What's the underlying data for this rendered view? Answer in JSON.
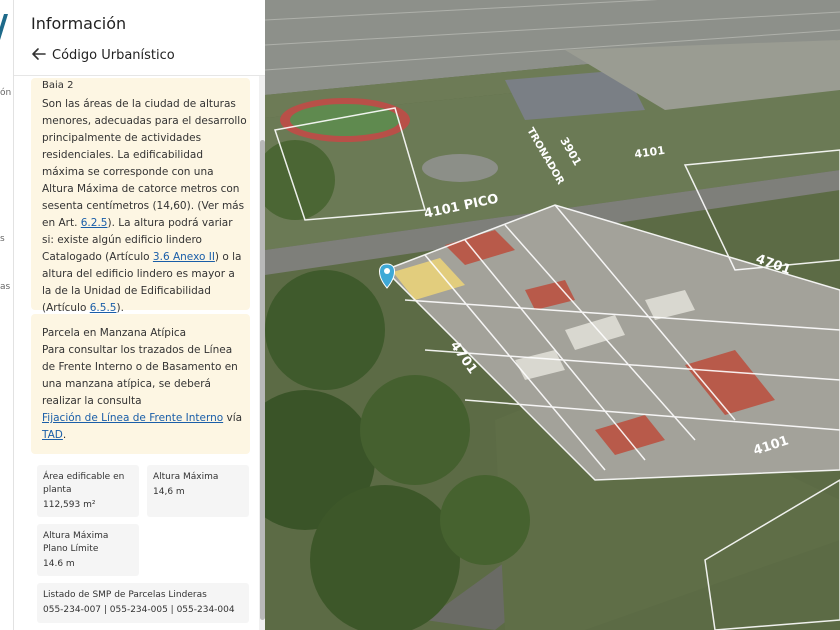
{
  "rail": {
    "items": [
      "ón",
      "s",
      "as"
    ]
  },
  "panel": {
    "title": "Información",
    "subtitle": "Código Urbanístico"
  },
  "card_zone": {
    "clipped_title": "Baja 2",
    "text_before_link1": "Son las áreas de la ciudad de alturas menores, adecuadas para el desarrollo principalmente de actividades residenciales. La edificabilidad máxima se corresponde con una Altura Máxima de catorce metros con sesenta centímetros (14,60). (Ver más en Art. ",
    "link1": "6.2.5",
    "text_before_link2": "). La altura podrá variar si: existe algún edificio lindero Catalogado (Artículo ",
    "link2": "3.6 Anexo II",
    "text_before_link3": ") o la altura del edificio lindero es mayor a la de la Unidad de Edificabilidad (Artículo ",
    "link3": "6.5.5",
    "text_end": ")."
  },
  "card_parcela": {
    "title": "Parcela en Manzana Atípica",
    "text": "Para consultar los trazados de Línea de Frente Interno o de Basamento en una manzana atípica, se deberá realizar la consulta",
    "link1": "Fijación de Línea de Frente Interno",
    "text_mid": " vía",
    "link2": "TAD",
    "text_end": "."
  },
  "stats": [
    {
      "label": "Área edificable en planta",
      "value": "112,593 m²"
    },
    {
      "label": "Altura Máxima",
      "value": "14,6 m"
    },
    {
      "label": "Altura Máxima Plano Límite",
      "value": "14.6 m"
    },
    {
      "label": "Listado de SMP de Parcelas Linderas",
      "value": "055-234-007 | 055-234-005 | 055-234-004"
    }
  ],
  "map": {
    "street_labels": [
      "4101 PICO",
      "4701",
      "4701",
      "4101",
      "3901",
      "TRONADOR",
      "4101"
    ],
    "pin_color": "#3fa9d6",
    "accent": "#1a5ea8"
  }
}
